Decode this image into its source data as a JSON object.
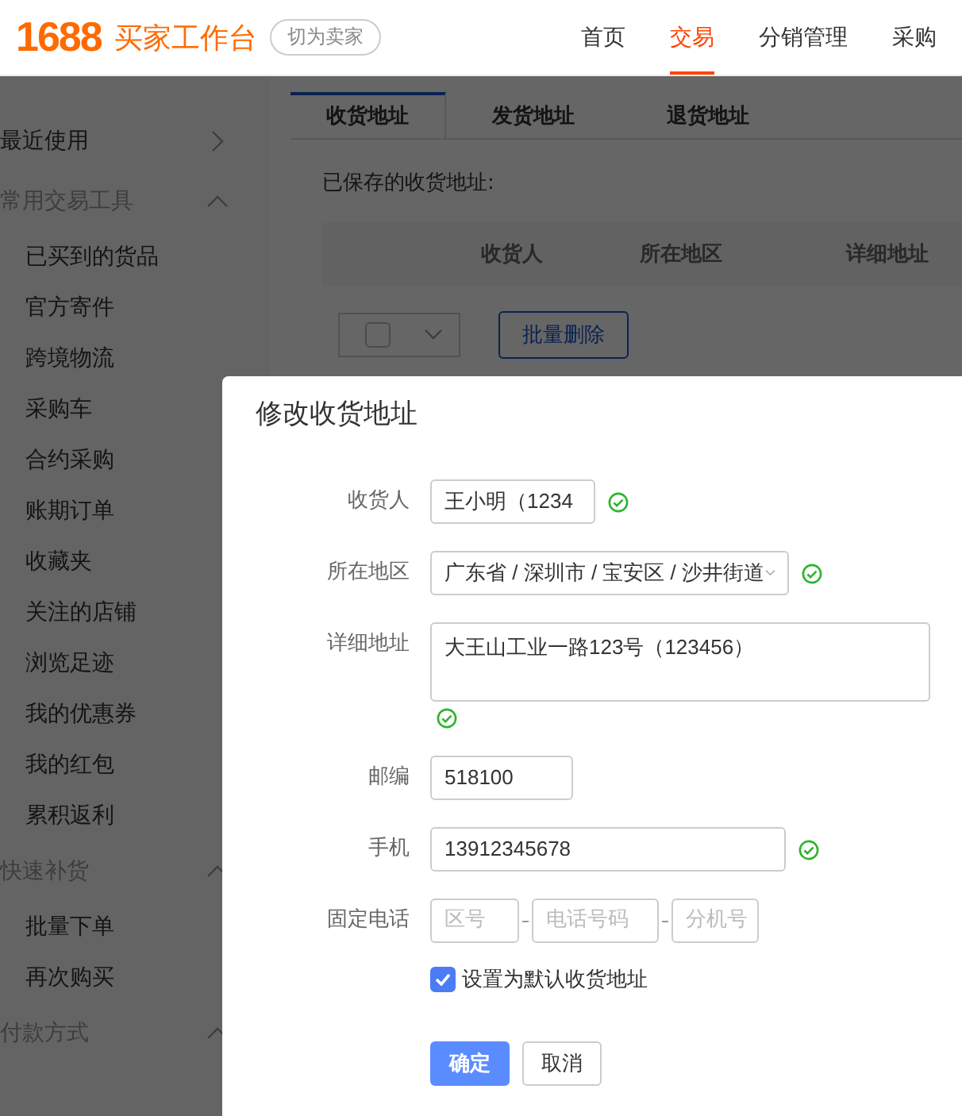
{
  "header": {
    "logo_number": "1688",
    "logo_text": "买家工作台",
    "switch_button": "切为卖家",
    "nav": [
      {
        "label": "首页",
        "selected": false
      },
      {
        "label": "交易",
        "selected": true
      },
      {
        "label": "分销管理",
        "selected": false
      },
      {
        "label": "采购",
        "selected": false
      }
    ]
  },
  "sidebar": {
    "groups": [
      {
        "label": "最近使用",
        "expanded": false
      },
      {
        "label": "常用交易工具",
        "expanded": true,
        "children": [
          "已买到的货品",
          "官方寄件",
          "跨境物流",
          "采购车",
          "合约采购",
          "账期订单",
          "收藏夹",
          "关注的店铺",
          "浏览足迹",
          "我的优惠券",
          "我的红包",
          "累积返利"
        ]
      },
      {
        "label": "快速补货",
        "expanded": true,
        "children": [
          "批量下单",
          "再次购买"
        ]
      },
      {
        "label": "付款方式",
        "expanded": true
      }
    ]
  },
  "tabs": [
    {
      "label": "收货地址",
      "selected": true
    },
    {
      "label": "发货地址",
      "selected": false
    },
    {
      "label": "退货地址",
      "selected": false
    }
  ],
  "saved_label": "已保存的收货地址:",
  "table": {
    "columns": [
      "收货人",
      "所在地区",
      "详细地址"
    ],
    "select_all_checked": false,
    "bulk_delete": "批量删除"
  },
  "dialog": {
    "title": "修改收货地址",
    "fields": [
      {
        "kind": "text",
        "label": "收货人",
        "value": "王小明（1234",
        "valid": true
      },
      {
        "kind": "select",
        "label": "所在地区",
        "value": "广东省 / 深圳市 / 宝安区 / 沙井街道",
        "valid": true
      },
      {
        "kind": "textarea",
        "label": "详细地址",
        "value": "大王山工业一路123号（123456）",
        "valid": true
      },
      {
        "kind": "text",
        "label": "邮编",
        "value": "518100"
      },
      {
        "kind": "text",
        "label": "手机",
        "value": "13912345678",
        "valid": true
      },
      {
        "kind": "phone",
        "label": "固定电话",
        "parts": [
          {
            "placeholder": "区号"
          },
          {
            "placeholder": "电话号码"
          },
          {
            "placeholder": "分机号"
          }
        ]
      }
    ],
    "default_checkbox": {
      "label": "设置为默认收货地址",
      "checked": true
    },
    "buttons": [
      {
        "label": "确定",
        "kind": "primary"
      },
      {
        "label": "取消",
        "kind": "secondary"
      }
    ]
  }
}
